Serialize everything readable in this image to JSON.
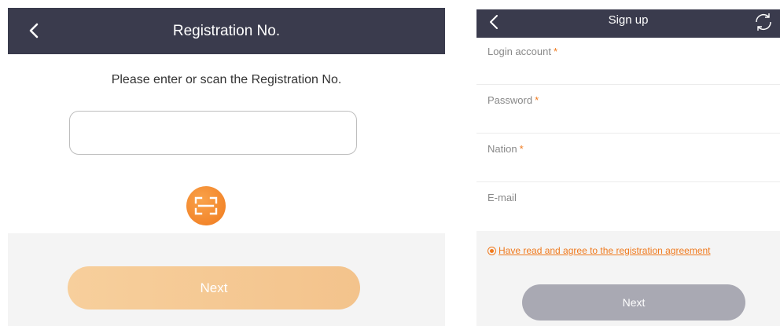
{
  "registration": {
    "title": "Registration No.",
    "prompt": "Please enter or scan the Registration No.",
    "input_value": "",
    "next_label": "Next",
    "colors": {
      "header": "#3a3b4d",
      "accent": "#f07a1e",
      "next_button": "#f5c893"
    },
    "icons": {
      "back": "chevron-left-icon",
      "scan": "scan-icon"
    }
  },
  "signup": {
    "title": "Sign up",
    "fields": [
      {
        "label": "Login account",
        "required_mark": "*"
      },
      {
        "label": "Password",
        "required_mark": "*"
      },
      {
        "label": "Nation",
        "required_mark": "*"
      },
      {
        "label": "E-mail",
        "required_mark": ""
      }
    ],
    "agreement_text": "Have read and agree to the registration agreement",
    "agreement_checked": true,
    "next_label": "Next",
    "colors": {
      "header": "#3a3b4d",
      "accent": "#f07a1e",
      "next_button": "#a9a9b3"
    },
    "icons": {
      "back": "chevron-left-icon",
      "refresh": "refresh-icon"
    }
  }
}
